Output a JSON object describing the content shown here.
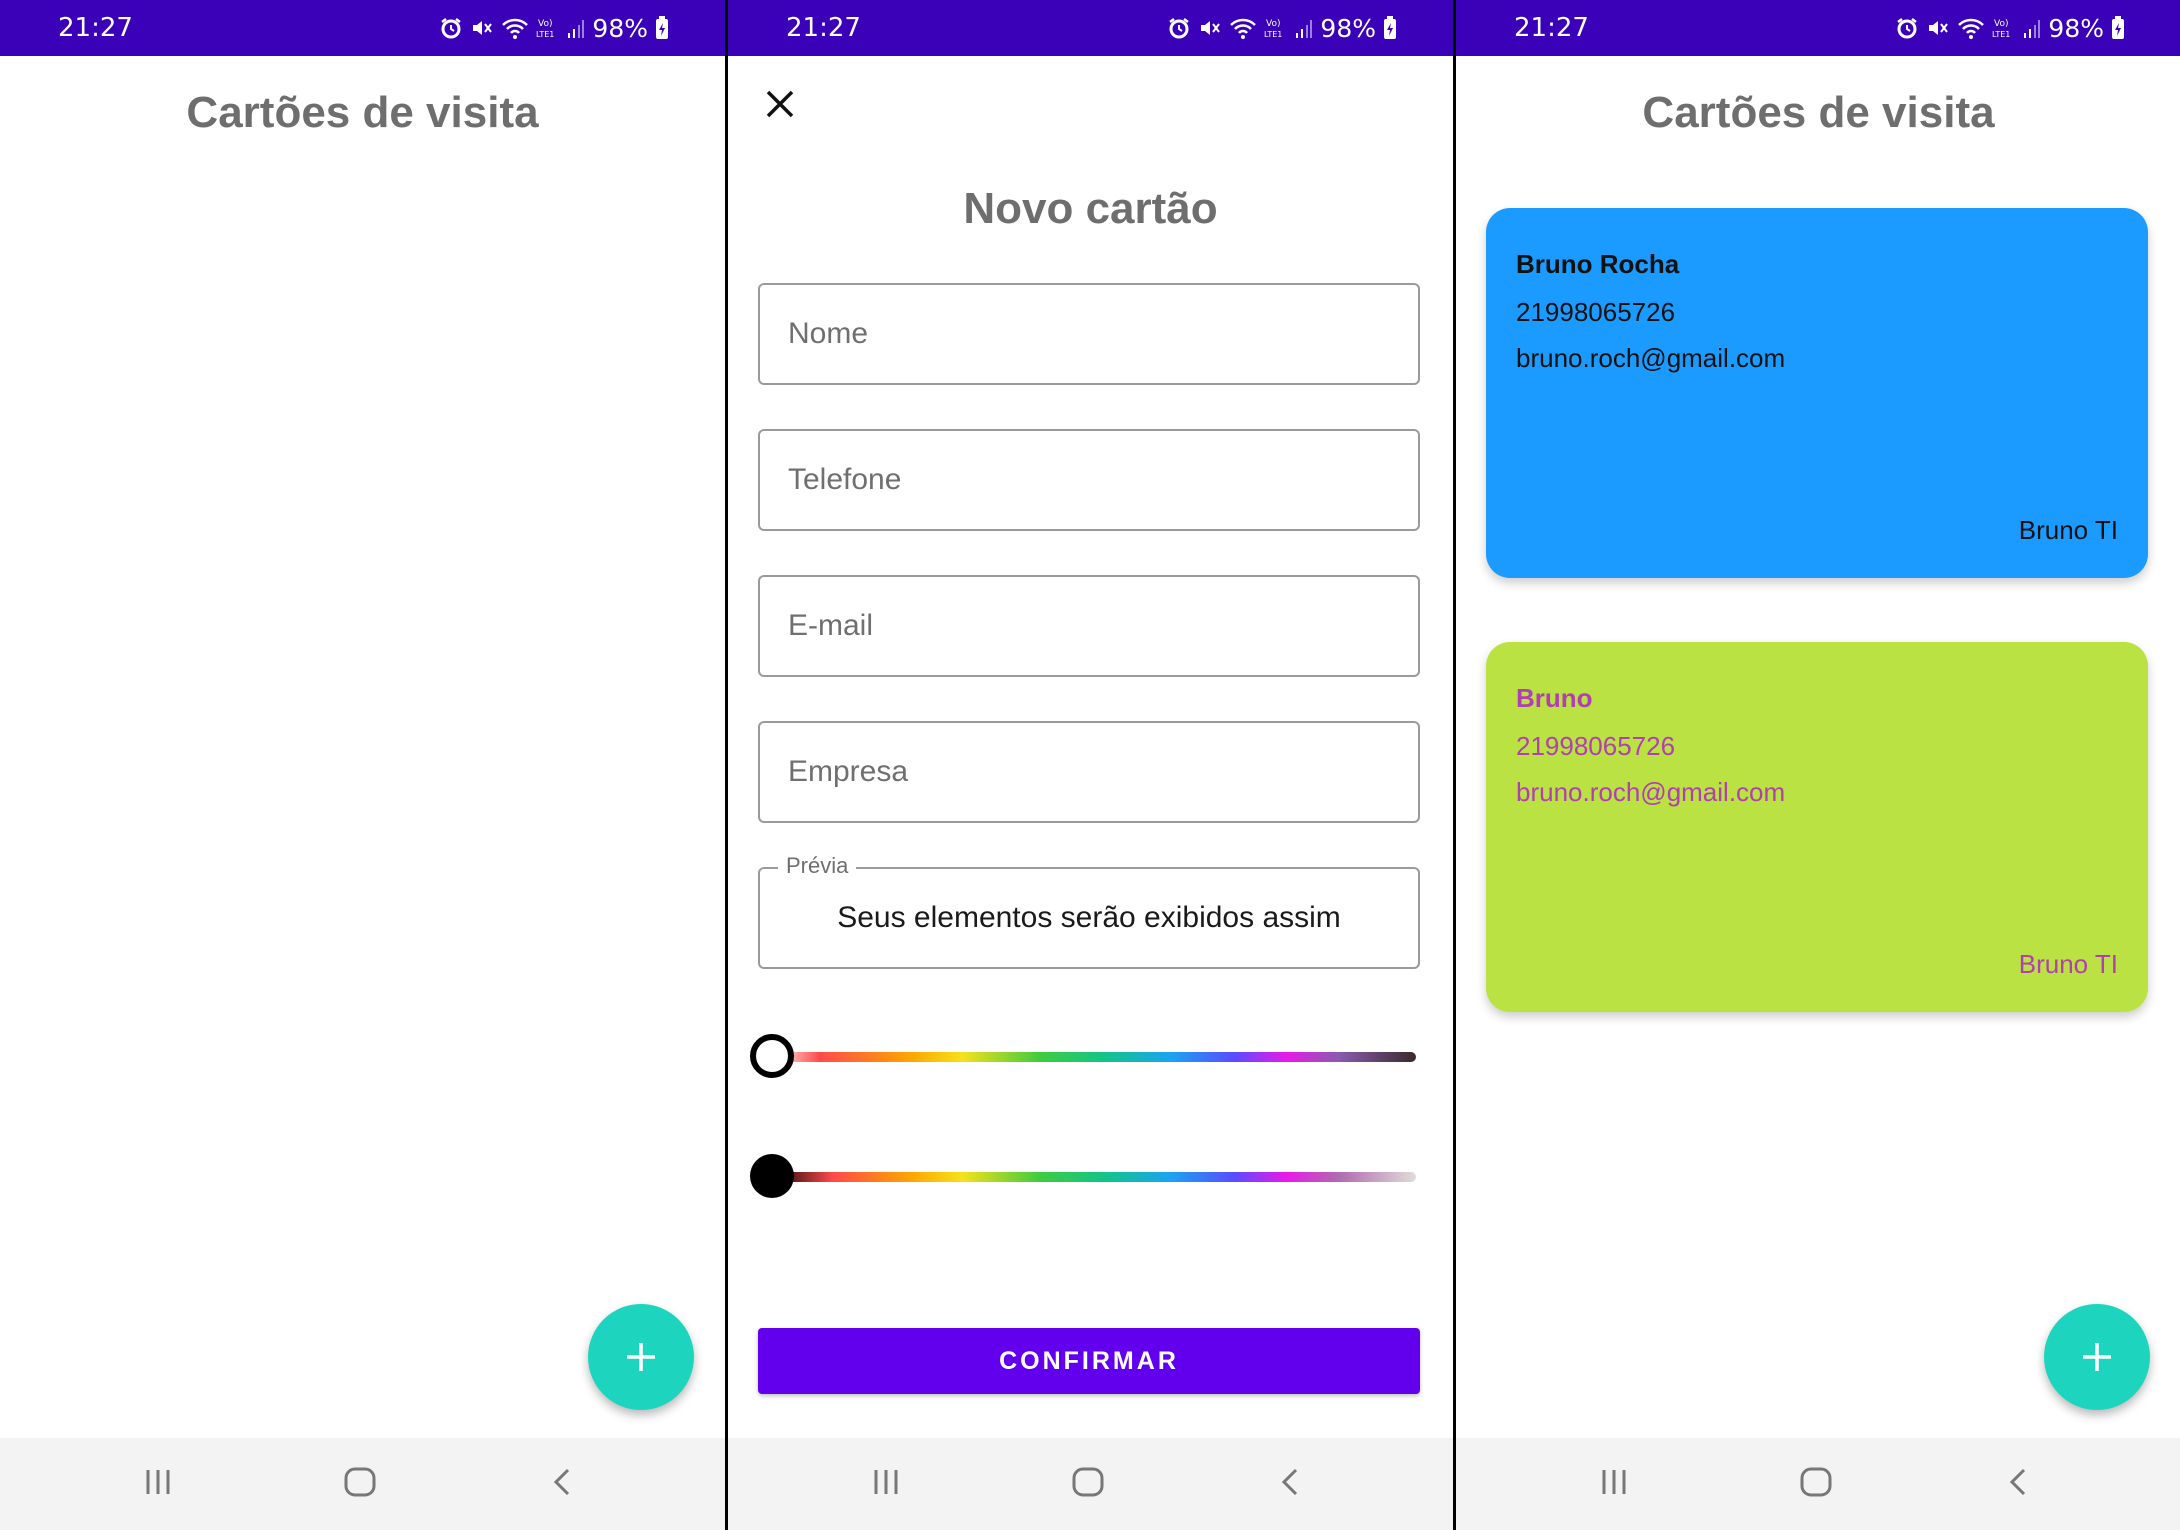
{
  "status_bar": {
    "time": "21:27",
    "battery": "98%",
    "background": "#3b01b8"
  },
  "screen1": {
    "title": "Cartões de visita",
    "fab_icon": "plus-icon"
  },
  "screen2": {
    "close_icon": "close-icon",
    "title": "Novo cartão",
    "fields": {
      "nome": "Nome",
      "telefone": "Telefone",
      "email": "E-mail",
      "empresa": "Empresa"
    },
    "preview": {
      "label": "Prévia",
      "text": "Seus elementos serão exibidos assim"
    },
    "sliders": {
      "background_color_level": 0,
      "text_color_level": 0
    },
    "confirm_label": "CONFIRMAR",
    "confirm_color": "#6200ee"
  },
  "screen3": {
    "title": "Cartões de visita",
    "cards": [
      {
        "name": "Bruno Rocha",
        "phone": "21998065726",
        "email": "bruno.roch@gmail.com",
        "company": "Bruno TI",
        "background": "#1b9bff",
        "text_color": "#111111"
      },
      {
        "name": "Bruno",
        "phone": "21998065726",
        "email": "bruno.roch@gmail.com",
        "company": "Bruno TI",
        "background": "#bae243",
        "text_color": "#b23fb2"
      }
    ],
    "fab_icon": "plus-icon"
  },
  "colors": {
    "fab": "#1dd5be",
    "title_gray": "#6e6e6e"
  },
  "nav_bar": [
    "recents-icon",
    "home-icon",
    "back-icon"
  ]
}
